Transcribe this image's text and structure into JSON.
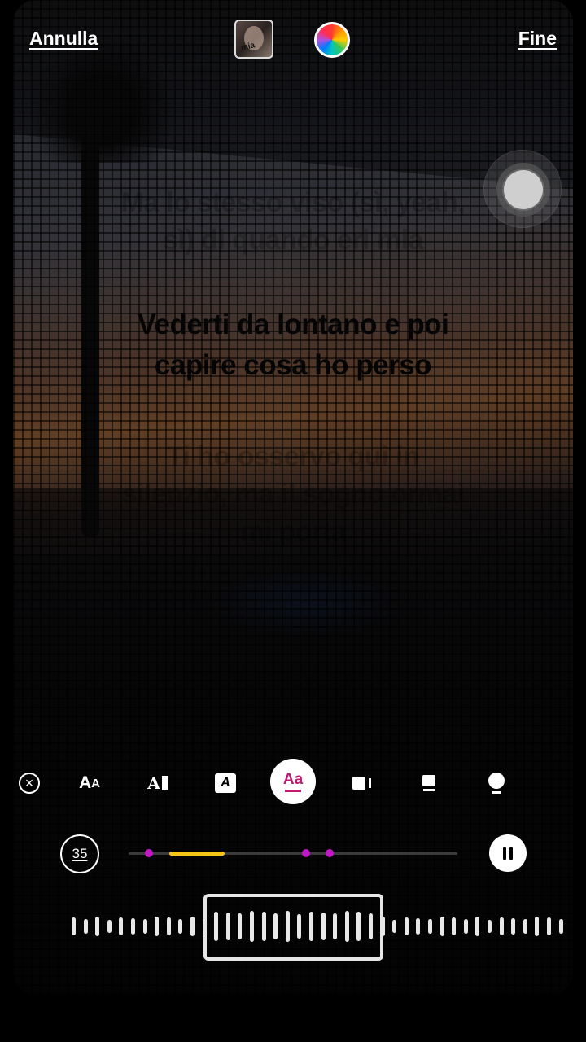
{
  "header": {
    "cancel_label": "Annulla",
    "done_label": "Fine",
    "album_cover_text": "mia"
  },
  "icons": {
    "album": "album-cover",
    "color": "color-wheel-icon",
    "record": "record-button-icon",
    "close": "close-icon",
    "tools": [
      "text-size-icon",
      "text-align-icon",
      "text-background-icon",
      "text-style-icon",
      "video-icon",
      "card-icon",
      "bulb-icon"
    ],
    "pause": "pause-icon"
  },
  "lyrics": {
    "previous": "Ma lo stesso viso (sì, yeah, sì) di quando eri mia",
    "current": "Vederti da lontano e poi capire cosa ho perso",
    "next": "Ti ho osservo qui in silenzio, ma il sogno ormai mi porta"
  },
  "toolbar": {
    "size_big": "A",
    "size_small": "A",
    "align_label": "A",
    "background_label": "A",
    "style_label": "Aa"
  },
  "player": {
    "duration": "35",
    "progress_fraction": 0.12,
    "colors": {
      "accent": "#c01a70",
      "progress": "#f5c518",
      "marker": "#c218c8"
    }
  }
}
